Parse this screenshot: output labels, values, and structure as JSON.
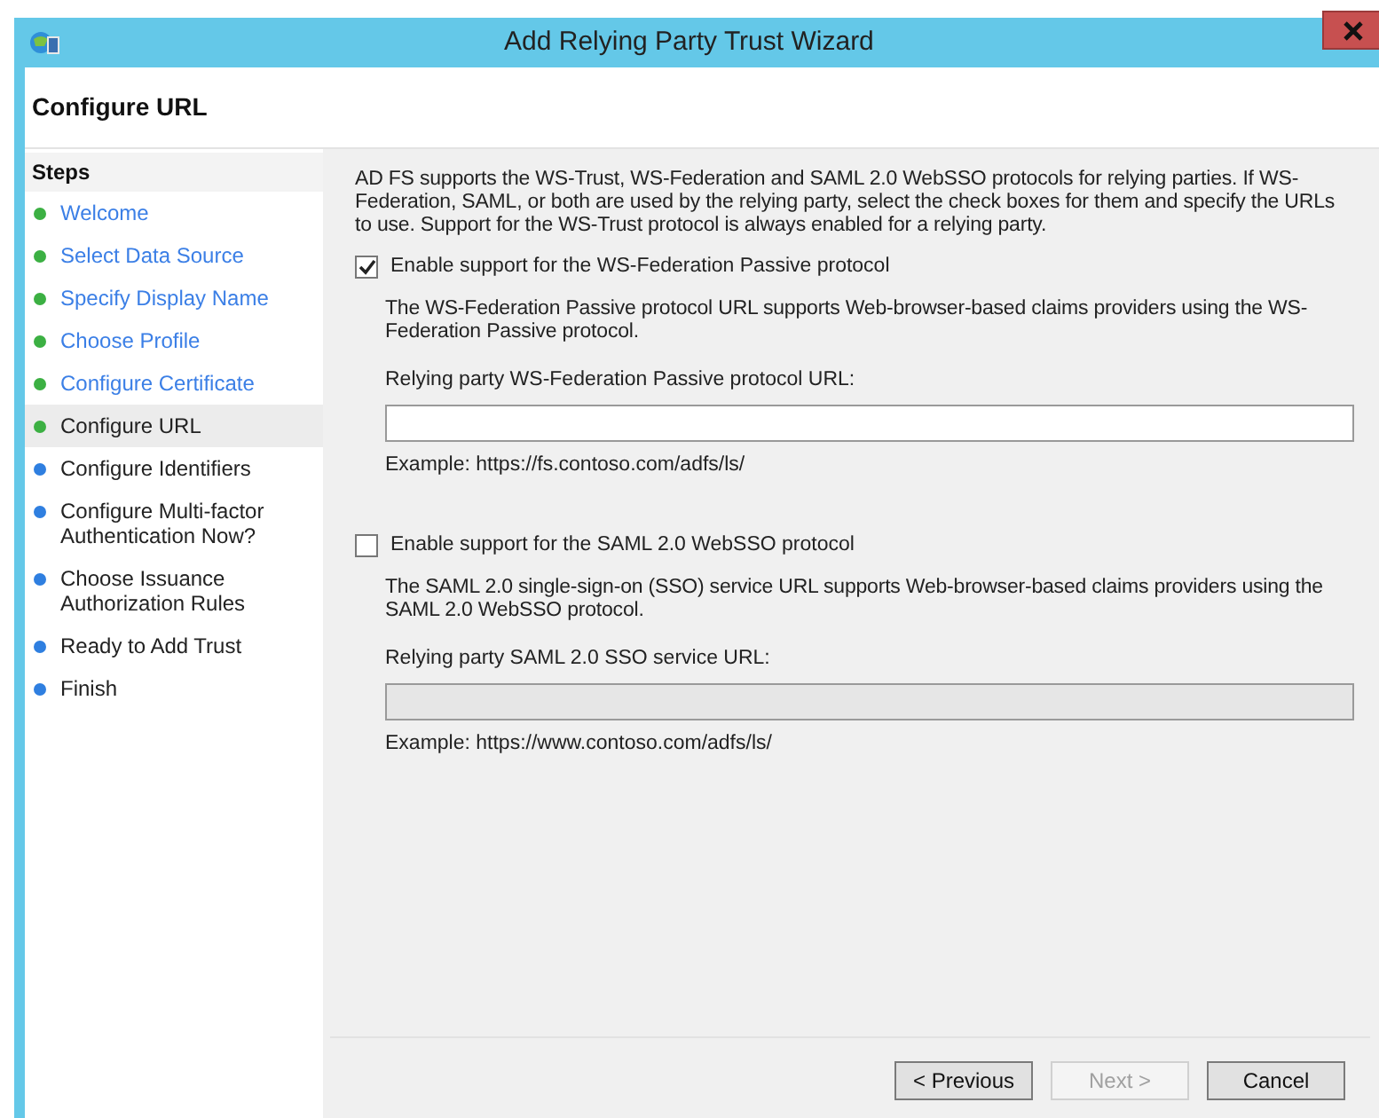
{
  "window": {
    "title": "Add Relying Party Trust Wizard"
  },
  "header": {
    "title": "Configure URL"
  },
  "steps": {
    "heading": "Steps",
    "items": [
      {
        "label": "Welcome",
        "completed": true,
        "selected": false
      },
      {
        "label": "Select Data Source",
        "completed": true,
        "selected": false
      },
      {
        "label": "Specify Display Name",
        "completed": true,
        "selected": false
      },
      {
        "label": "Choose Profile",
        "completed": true,
        "selected": false
      },
      {
        "label": "Configure Certificate",
        "completed": true,
        "selected": false
      },
      {
        "label": "Configure URL",
        "completed": true,
        "selected": true
      },
      {
        "label": "Configure Identifiers",
        "completed": false,
        "selected": false
      },
      {
        "label": "Configure Multi-factor Authentication Now?",
        "completed": false,
        "selected": false
      },
      {
        "label": "Choose Issuance Authorization Rules",
        "completed": false,
        "selected": false
      },
      {
        "label": "Ready to Add Trust",
        "completed": false,
        "selected": false
      },
      {
        "label": "Finish",
        "completed": false,
        "selected": false
      }
    ]
  },
  "intro": "AD FS supports the WS-Trust, WS-Federation and SAML 2.0 WebSSO protocols for relying parties.  If WS-Federation, SAML, or both are used by the relying party, select the check boxes for them and specify the URLs to use.  Support for the WS-Trust protocol is always enabled for a relying party.",
  "options": [
    {
      "label": "Enable support for the WS-Federation Passive protocol",
      "checked": true,
      "description": "The WS-Federation Passive protocol URL supports Web-browser-based claims providers using the WS-Federation Passive protocol.",
      "field_label": "Relying party WS-Federation Passive protocol URL:",
      "disabled": false,
      "example": "Example: https://fs.contoso.com/adfs/ls/"
    },
    {
      "label": "Enable support for the SAML 2.0 WebSSO protocol",
      "checked": false,
      "description": "The SAML 2.0 single-sign-on (SSO) service URL supports Web-browser-based claims providers using the SAML 2.0 WebSSO protocol.",
      "field_label": "Relying party SAML 2.0 SSO service URL:",
      "disabled": true,
      "example": "Example: https://www.contoso.com/adfs/ls/"
    }
  ],
  "buttons": [
    {
      "label": "< Previous",
      "disabled": false
    },
    {
      "label": "Next >",
      "disabled": true
    },
    {
      "label": "Cancel",
      "disabled": false
    }
  ]
}
